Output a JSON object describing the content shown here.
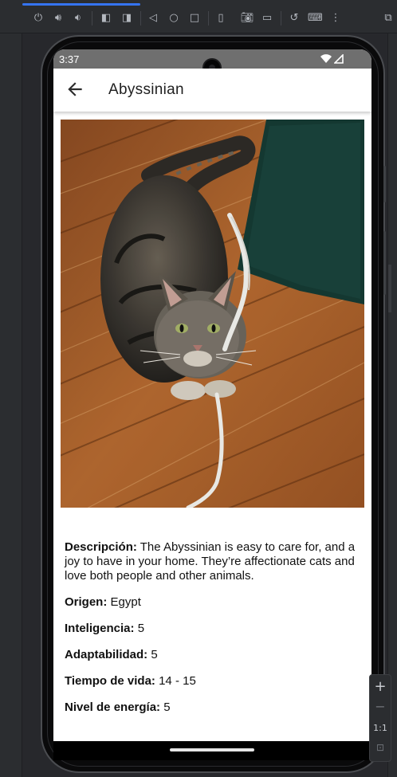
{
  "device": {
    "status_time": "3:37",
    "status_icons": [
      "wifi-icon",
      "signal-icon"
    ]
  },
  "emulator_toolbar": {
    "buttons": [
      "power-icon",
      "volume-up-icon",
      "volume-down-icon",
      "rotate-left-icon",
      "rotate-right-icon",
      "back-icon",
      "home-icon",
      "overview-icon",
      "fold-icon",
      "camera-icon",
      "record-icon",
      "reset-icon",
      "keyboard-icon",
      "more-icon"
    ],
    "zoom": {
      "plus": "+",
      "minus": "−",
      "ratio": "1:1"
    }
  },
  "app": {
    "title": "Abyssinian",
    "image_alt": "cat photo",
    "details": [
      {
        "label": "Descripción:",
        "value": " The Abyssinian is easy to care for, and a joy to have in your home. They’re affectionate cats and love both people and other animals."
      },
      {
        "label": "Origen:",
        "value": " Egypt"
      },
      {
        "label": "Inteligencia:",
        "value": " 5"
      },
      {
        "label": "Adaptabilidad:",
        "value": " 5"
      },
      {
        "label": "Tiempo de vida:",
        "value": " 14 - 15"
      },
      {
        "label": "Nivel de energía:",
        "value": " 5"
      }
    ]
  },
  "colors": {
    "status_bar": "#6f6f6f",
    "app_bar": "#ffffff",
    "emulator_bg": "#27282c",
    "accent": "#3574f0"
  }
}
